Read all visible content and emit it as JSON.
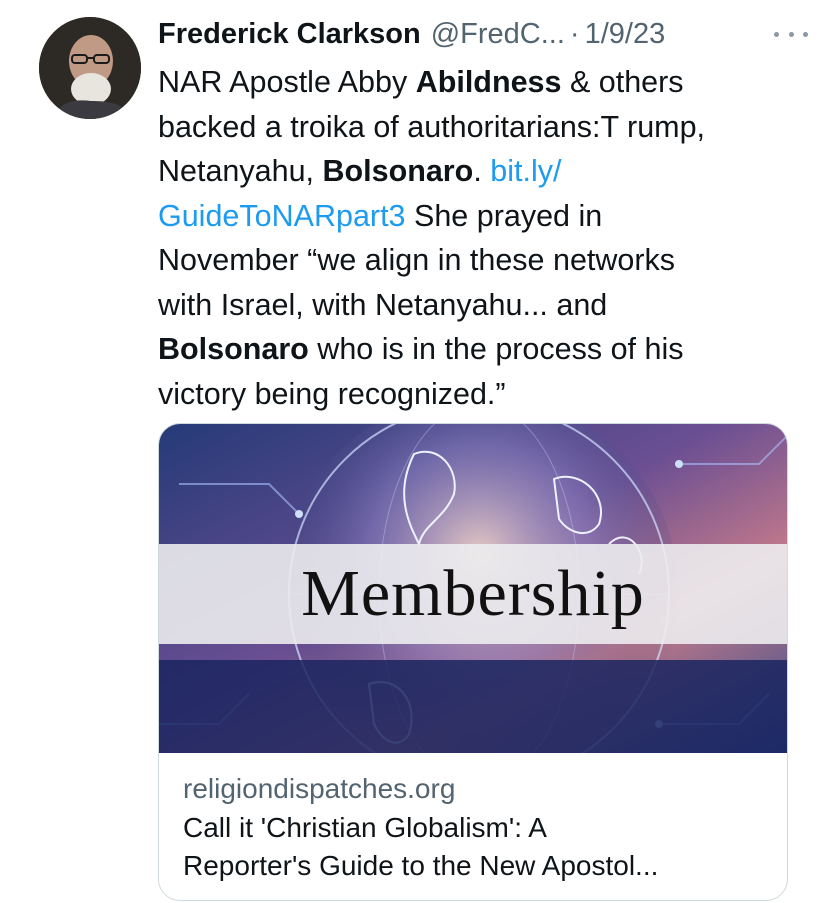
{
  "tweet": {
    "author_name": "Frederick Clarkson",
    "handle": "@FredC...",
    "separator": "·",
    "date": "1/9/23",
    "lines": [
      [
        {
          "t": "NAR Apostle Abby "
        },
        {
          "t": "Abildness",
          "s": "b"
        },
        {
          "t": " & others"
        }
      ],
      [
        {
          "t": "backed a troika of authoritarians:T rump,"
        }
      ],
      [
        {
          "t": "Netanyahu, "
        },
        {
          "t": "Bolsonaro",
          "s": "b"
        },
        {
          "t": ".  "
        },
        {
          "t": "bit.ly/",
          "s": "link"
        }
      ],
      [
        {
          "t": "GuideToNARpart3",
          "s": "link"
        },
        {
          "t": " She prayed in"
        }
      ],
      [
        {
          "t": "November “we align in these networks"
        }
      ],
      [
        {
          "t": "with Israel, with Netanyahu... and"
        }
      ],
      [
        {
          "t": "Bolsonaro",
          "s": "b"
        },
        {
          "t": " who is in the process of his"
        }
      ],
      [
        {
          "t": "victory being recognized.”"
        }
      ]
    ]
  },
  "card": {
    "image_text": "Membership",
    "domain": "religiondispatches.org",
    "title_line1": "Call it 'Christian Globalism': A",
    "title_line2": "Reporter's Guide to the New Apostol..."
  },
  "colors": {
    "link": "#1d9bf0",
    "secondary_text": "#536471",
    "band_blue": "#1b2560"
  },
  "icons": [
    "more-options-icon"
  ]
}
